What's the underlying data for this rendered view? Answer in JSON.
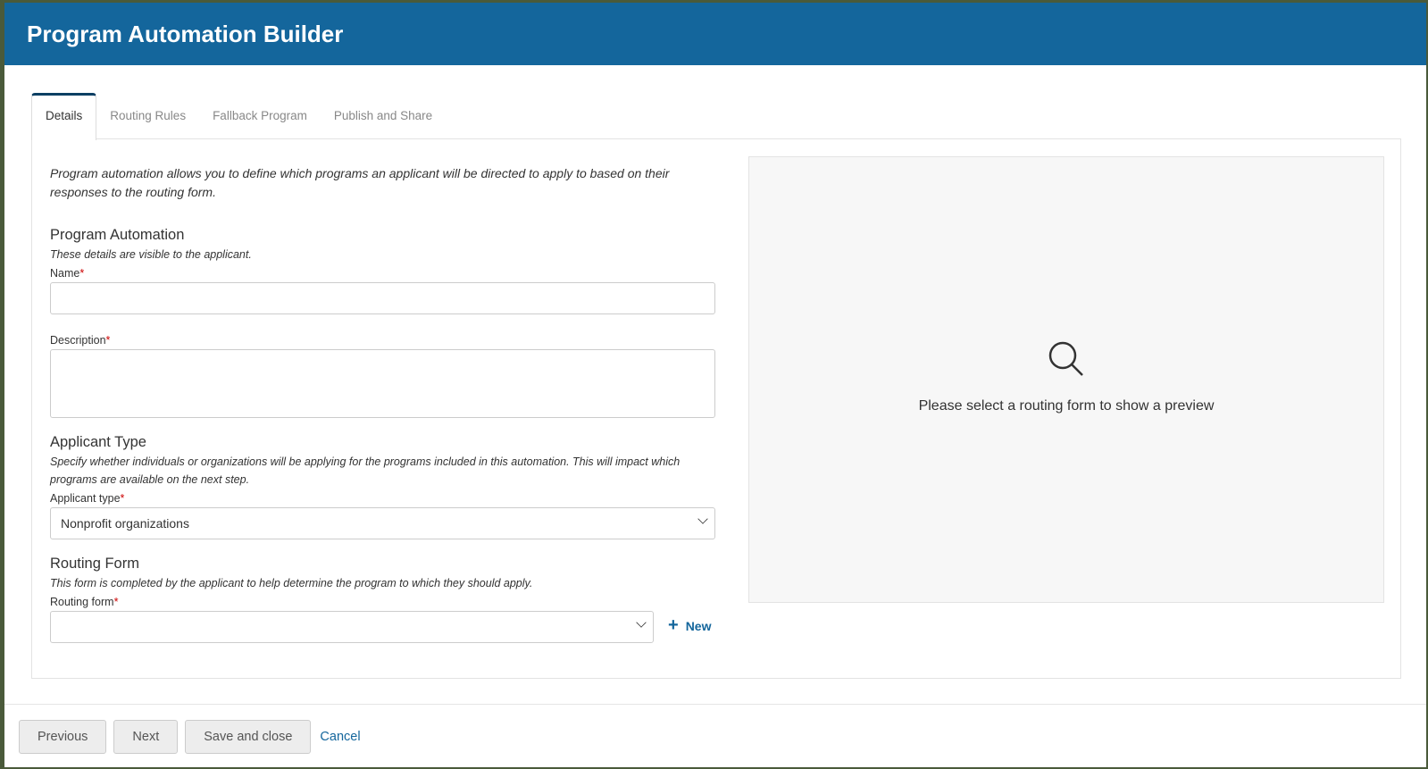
{
  "header": {
    "title": "Program Automation Builder"
  },
  "tabs": [
    {
      "label": "Details",
      "active": true
    },
    {
      "label": "Routing Rules"
    },
    {
      "label": "Fallback Program"
    },
    {
      "label": "Publish and Share"
    }
  ],
  "details": {
    "intro": "Program automation allows you to define which programs an applicant will be directed to apply to based on their responses to the routing form.",
    "program_automation": {
      "title": "Program Automation",
      "subtitle": "These details are visible to the applicant.",
      "name_label": "Name",
      "name_value": "",
      "description_label": "Description",
      "description_value": ""
    },
    "applicant_type": {
      "title": "Applicant Type",
      "subtitle": "Specify whether individuals or organizations will be applying for the programs included in this automation. This will impact which programs are available on the next step.",
      "label": "Applicant type",
      "value": "Nonprofit organizations"
    },
    "routing_form": {
      "title": "Routing Form",
      "subtitle": "This form is completed by the applicant to help determine the program to which they should apply.",
      "label": "Routing form",
      "value": "",
      "new_label": "New"
    },
    "required_mark": "*"
  },
  "preview": {
    "icon": "search-icon",
    "text": "Please select a routing form to show a preview"
  },
  "footer": {
    "previous": "Previous",
    "next": "Next",
    "save_close": "Save and close",
    "cancel": "Cancel"
  },
  "colors": {
    "header": "#14669c",
    "link": "#14669c",
    "required": "#cc0000"
  }
}
